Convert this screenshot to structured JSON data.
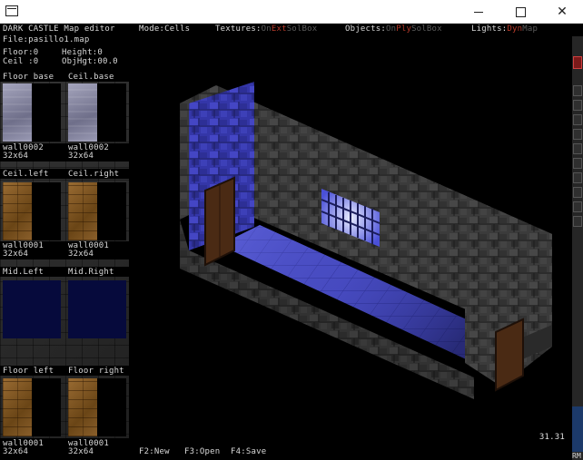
{
  "window": {
    "title": "",
    "controls": {
      "minimize": "minimize",
      "maximize": "maximize",
      "close": "✕"
    }
  },
  "header": {
    "app_title": "DARK CASTLE Map editor",
    "file_label": "File:pasillo1.map",
    "mode": "Mode:Cells",
    "textures_label": "Textures:",
    "textures_opt1": "On",
    "textures_opt2": "Ext",
    "textures_opt3": "SolBox",
    "objects_label": "Objects:",
    "objects_opt1": "On",
    "objects_opt2": "Ply",
    "objects_opt3": "SolBox",
    "lights_label": "Lights:",
    "lights_opt1": "Dyn",
    "lights_opt2": "Map"
  },
  "info": {
    "floor": "Floor:0",
    "height": "Height:0",
    "ceil": "Ceil :0",
    "objhgt": "ObjHgt:00.0"
  },
  "textures": [
    {
      "slot": "Floor base",
      "name": "wall0002",
      "size": "32x64",
      "kind": "wall2"
    },
    {
      "slot": "Ceil.base",
      "name": "wall0002",
      "size": "32x64",
      "kind": "wall2"
    },
    {
      "slot": "Ceil.left",
      "name": "wall0001",
      "size": "32x64",
      "kind": "wall1"
    },
    {
      "slot": "Ceil.right",
      "name": "wall0001",
      "size": "32x64",
      "kind": "wall1"
    },
    {
      "slot": "Mid.Left",
      "name": "",
      "size": "",
      "kind": "mid"
    },
    {
      "slot": "Mid.Right",
      "name": "",
      "size": "",
      "kind": "mid"
    },
    {
      "slot": "Floor left",
      "name": "wall0001",
      "size": "32x64",
      "kind": "wall1"
    },
    {
      "slot": "Floor right",
      "name": "wall0001",
      "size": "32x64",
      "kind": "wall1"
    }
  ],
  "footer": {
    "f2": "F2:New",
    "f3": "F3:Open",
    "f4": "F4:Save"
  },
  "status": {
    "fps": "31.31",
    "right_marker": "RM"
  },
  "icons": [
    "app-icon",
    "minimize-icon",
    "maximize-icon",
    "close-icon",
    "hand-tool-icon"
  ],
  "colors": {
    "accent_red": "#b73a2a",
    "wall_blue": "#3d3fb8",
    "stone_gray": "#3a3a3a"
  }
}
